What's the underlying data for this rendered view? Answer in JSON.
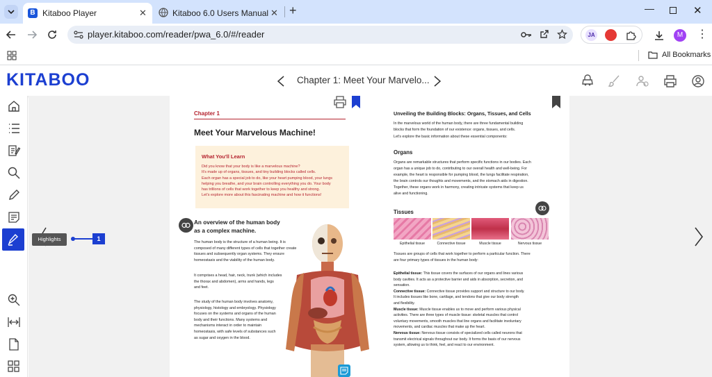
{
  "browser": {
    "tabs": [
      {
        "title": "Kitaboo Player",
        "favicon": "B"
      },
      {
        "title": "Kitaboo 6.0 Users Manual"
      }
    ],
    "url": "player.kitaboo.com/reader/pwa_6.0/#/reader",
    "all_bookmarks": "All Bookmarks",
    "profile_initial": "M",
    "ext_initials": "JA"
  },
  "app": {
    "logo": "KITABOO",
    "chapter_title": "Chapter 1: Meet Your Marvelo...",
    "highlights_tooltip": "Highlights",
    "callout_number": "1",
    "accent": "#1c3fd1"
  },
  "left_page": {
    "chapter_label": "Chapter 1",
    "title": "Meet Your Marvelous Machine!",
    "learn_title": "What You'll Learn",
    "learn_lines": [
      "Did you know that your body is like a marvelous machine?",
      "It's made up of organs, tissues, and tiny building blocks called cells.",
      "Each organ has a special job to do, like your heart pumping blood, your lungs",
      "helping you breathe, and your brain controlling everything you do. Your body",
      "has trillions of cells that work together to keep you healthy and strong.",
      "Let's explore more about this fascinating machine and how it functions!"
    ],
    "overview_title_1": "An overview of the human body",
    "overview_title_2": "as a complex machine.",
    "para1": [
      "The human body is the structure of a human being. It is",
      "composed of many different types of cells that together create",
      "tissues and subsequently organ systems. They ensure",
      "homeostasis and the viability of the human body."
    ],
    "para2": [
      "It comprises a head, hair, neck, trunk (which includes",
      "the thorax and abdomen), arms and hands, legs",
      "and feet."
    ],
    "para3": [
      "The study of the human body involves anatomy,",
      "physiology, histology and embryology. Physiology",
      "focuses on the systems and organs of the human",
      "body and their functions. Many systems and",
      "mechanisms interact in order to maintain",
      "homeostasis, with safe levels of substances such",
      "as sugar and oxygen in the blood."
    ]
  },
  "right_page": {
    "heading": "Unveiling the Building Blocks: Organs, Tissues, and Cells",
    "intro": [
      "In the marvelous world of the human body, there are three fundamental building",
      "blocks that form the foundation of our existence: organs, tissues, and cells.",
      "Let's explore the basic information about these essential components:"
    ],
    "organs_title": "Organs",
    "organs_text": [
      "Organs are remarkable structures that perform specific functions in our bodies. Each",
      "organ has a unique job to do, contributing to our overall health and well-being. For",
      "example, the heart is responsible for pumping blood, the lungs facilitate respiration,",
      "the brain controls our thoughts and movements, and the stomach aids in digestion.",
      "Together, these organs work in harmony, creating intricate systems that keep us",
      "alive and functioning."
    ],
    "tissues_title": "Tissues",
    "tissue_labels": [
      "Epithelial tissue",
      "Connective tissue",
      "Muscle tissue",
      "Nervous tissue"
    ],
    "tissues_intro": [
      "Tissues are groups of cells that work together to perform a particular function. There",
      "are four primary types of tissues in the human body:"
    ],
    "defs": [
      {
        "term": "Epithelial tissue:",
        "lines": [
          " This tissue covers the surfaces of our organs and lines various",
          "body cavities. It acts as a protective barrier and aids in absorption, secretion, and",
          "sensation."
        ]
      },
      {
        "term": "Connective tissue:",
        "lines": [
          " Connective tissue provides support and structure to our body.",
          "It includes tissues like bone, cartilage, and tendons that give our body strength",
          "and flexibility."
        ]
      },
      {
        "term": "Muscle tissue:",
        "lines": [
          " Muscle tissue enables us to move and perform various physical",
          "activities. There are three types of muscle tissue: skeletal muscles that control",
          "voluntary movements, smooth muscles that line organs and facilitate involuntary",
          "movements, and cardiac muscles that make up the heart."
        ]
      },
      {
        "term": "Nervous tissue:",
        "lines": [
          " Nervous tissue consists of specialized cells called neurons that",
          "transmit electrical signals throughout our body. It forms the basis of our nervous",
          "system, allowing us to think, feel, and react to our environment."
        ]
      }
    ]
  }
}
